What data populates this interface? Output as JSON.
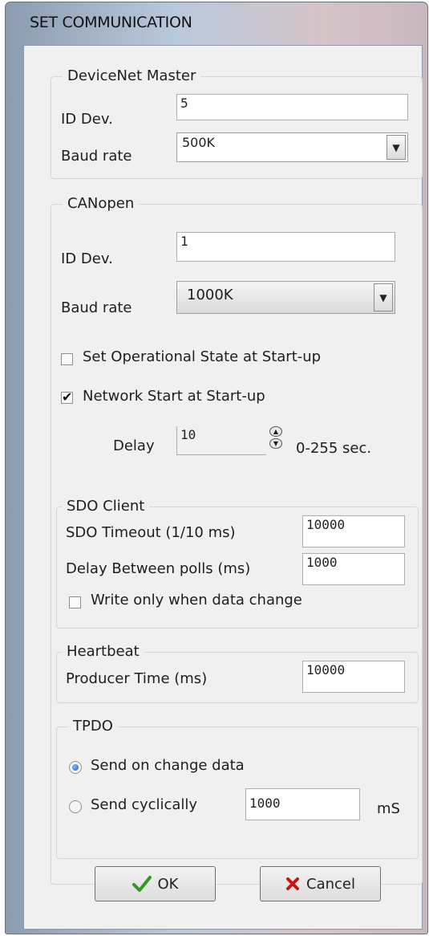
{
  "window": {
    "title": "SET COMMUNICATION"
  },
  "devicenet": {
    "group_label": "DeviceNet Master",
    "id_label": "ID Dev.",
    "id_value": "5",
    "baud_label": "Baud rate",
    "baud_value": "500K"
  },
  "canopen": {
    "group_label": "CANopen",
    "id_label": "ID Dev.",
    "id_value": "1",
    "baud_label": "Baud rate",
    "baud_value": "1000K",
    "set_operational_label": "Set Operational State at Start-up",
    "set_operational_checked": false,
    "network_start_label": "Network Start at Start-up",
    "network_start_checked": true,
    "delay_label": "Delay",
    "delay_value": "10",
    "delay_range": "0-255 sec."
  },
  "sdo_client": {
    "group_label": "SDO Client",
    "timeout_label": "SDO Timeout (1/10 ms)",
    "timeout_value": "10000",
    "poll_delay_label": "Delay Between polls (ms)",
    "poll_delay_value": "1000",
    "write_only_label": "Write only when data change",
    "write_only_checked": false
  },
  "heartbeat": {
    "group_label": "Heartbeat",
    "producer_label": "Producer Time (ms)",
    "producer_value": "10000"
  },
  "tpdo": {
    "group_label": "TPDO",
    "send_on_change_label": "Send on change data",
    "send_cyclically_label": "Send cyclically",
    "cyclic_value": "1000",
    "cyclic_unit": "mS",
    "selected": "send_on_change"
  },
  "buttons": {
    "ok_label": "OK",
    "cancel_label": "Cancel"
  },
  "colors": {
    "ok_check": "#2e9a1e",
    "cancel_x": "#c81414",
    "radio_selected": "#1e5fc8"
  }
}
